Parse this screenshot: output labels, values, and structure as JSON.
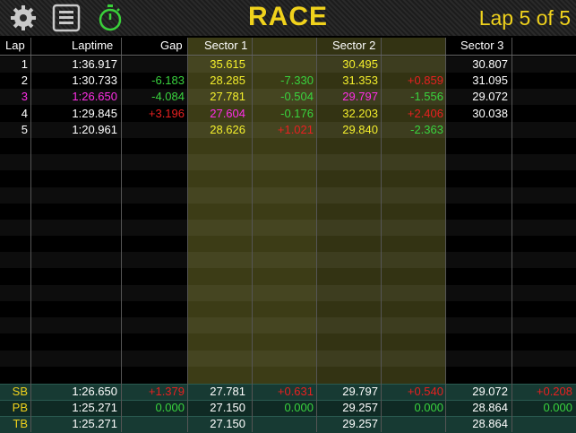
{
  "header": {
    "title": "RACE",
    "lap_info": "Lap 5 of 5"
  },
  "icons": [
    "gear-icon",
    "list-icon",
    "stopwatch-icon"
  ],
  "columns": {
    "lap": "Lap",
    "laptime": "Laptime",
    "gap": "Gap",
    "sector1": "Sector 1",
    "sector2": "Sector 2",
    "sector3": "Sector 3"
  },
  "laps": [
    {
      "lap": "1",
      "laptime": "1:36.917",
      "gap": "",
      "s1": "35.615",
      "s1d": "",
      "s2": "30.495",
      "s2d": "",
      "s3": "30.807",
      "s3d": ""
    },
    {
      "lap": "2",
      "laptime": "1:30.733",
      "gap": "-6.183",
      "s1": "28.285",
      "s1d": "-7.330",
      "s2": "31.353",
      "s2d": "+0.859",
      "s3": "31.095",
      "s3d": ""
    },
    {
      "lap": "3",
      "laptime": "1:26.650",
      "gap": "-4.084",
      "s1": "27.781",
      "s1d": "-0.504",
      "s2": "29.797",
      "s2d": "-1.556",
      "s3": "29.072",
      "s3d": ""
    },
    {
      "lap": "4",
      "laptime": "1:29.845",
      "gap": "+3.196",
      "s1": "27.604",
      "s1d": "-0.176",
      "s2": "32.203",
      "s2d": "+2.406",
      "s3": "30.038",
      "s3d": ""
    },
    {
      "lap": "5",
      "laptime": "1:20.961",
      "gap": "",
      "s1": "28.626",
      "s1d": "+1.021",
      "s2": "29.840",
      "s2d": "-2.363",
      "s3": "",
      "s3d": ""
    }
  ],
  "summary": [
    {
      "label": "SB",
      "laptime": "1:26.650",
      "gap": "+1.379",
      "s1": "27.781",
      "s1d": "+0.631",
      "s2": "29.797",
      "s2d": "+0.540",
      "s3": "29.072",
      "s3d": "+0.208"
    },
    {
      "label": "PB",
      "laptime": "1:25.271",
      "gap": "0.000",
      "s1": "27.150",
      "s1d": "0.000",
      "s2": "29.257",
      "s2d": "0.000",
      "s3": "28.864",
      "s3d": "0.000"
    },
    {
      "label": "TB",
      "laptime": "1:25.271",
      "gap": "",
      "s1": "27.150",
      "s1d": "",
      "s2": "29.257",
      "s2d": "",
      "s3": "28.864",
      "s3d": ""
    }
  ]
}
